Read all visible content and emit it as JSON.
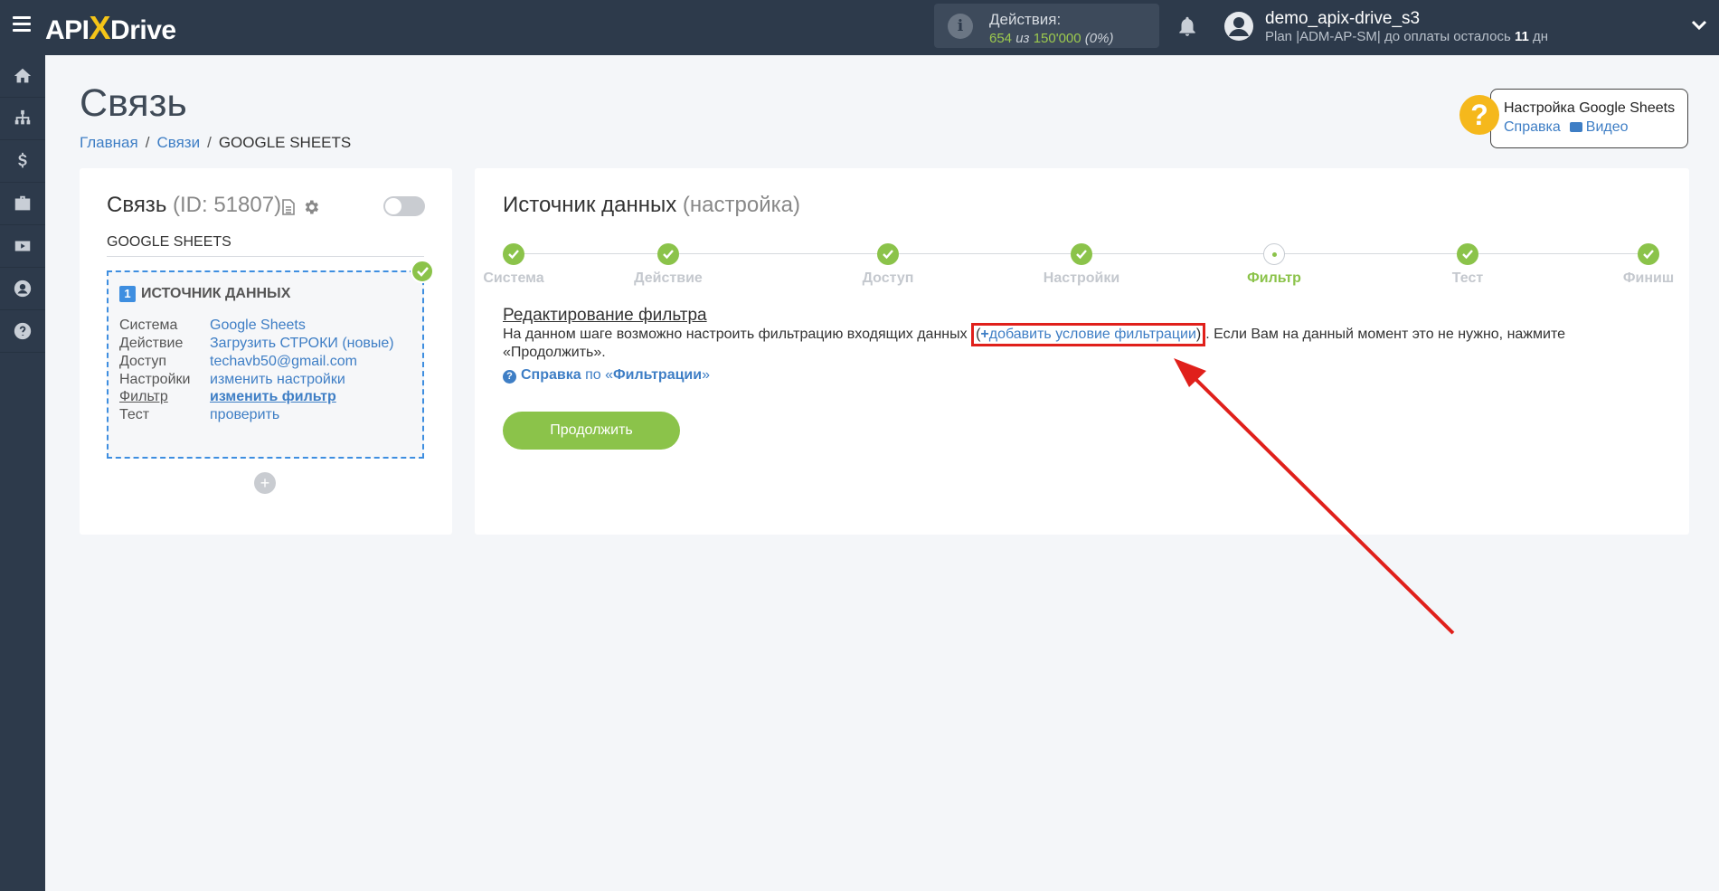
{
  "header": {
    "logo_left": "API",
    "logo_x": "X",
    "logo_right": "Drive",
    "actions_label": "Действия:",
    "actions_used": "654",
    "actions_of": "из",
    "actions_total": "150'000",
    "actions_pct": "(0%)",
    "user_name": "demo_apix-drive_s3",
    "plan_text": "Plan |ADM-AP-SM| до оплаты осталось",
    "plan_days": "11",
    "plan_days_unit": "дн"
  },
  "sidebar": {
    "items": [
      "home-icon",
      "sitemap-icon",
      "dollar-icon",
      "briefcase-icon",
      "youtube-icon",
      "user-icon",
      "help-icon"
    ]
  },
  "page": {
    "title": "Связь",
    "breadcrumb": [
      "Главная",
      "Связи",
      "GOOGLE SHEETS"
    ]
  },
  "help_box": {
    "title": "Настройка Google Sheets",
    "help": "Справка",
    "video": "Видео"
  },
  "connection": {
    "title": "Связь",
    "id_text": "(ID: 51807)",
    "system_name": "GOOGLE SHEETS",
    "source_number": "1",
    "source_title": "ИСТОЧНИК ДАННЫХ",
    "rows": [
      {
        "key": "Система",
        "value": "Google Sheets"
      },
      {
        "key": "Действие",
        "value": "Загрузить СТРОКИ (новые)"
      },
      {
        "key": "Доступ",
        "value": "techavb50@gmail.com"
      },
      {
        "key": "Настройки",
        "value": "изменить настройки"
      },
      {
        "key": "Фильтр",
        "value": "изменить фильтр"
      },
      {
        "key": "Тест",
        "value": "проверить"
      }
    ],
    "add_label": "+"
  },
  "source": {
    "title": "Источник данных",
    "subtitle": "(настройка)",
    "steps": [
      "Система",
      "Действие",
      "Доступ",
      "Настройки",
      "Фильтр",
      "Тест",
      "Финиш"
    ],
    "current_step": "Фильтр",
    "edit_title": "Редактирование фильтра",
    "desc_before": "На данном шаге возможно настроить фильтрацию входящих данных",
    "add_condition": "добавить условие фильтрации",
    "desc_after": ". Если Вам на данный момент это не нужно, нажмите «Продолжить».",
    "help_bold": "Справка",
    "help_mid": "по «",
    "help_bold2": "Фильтрации",
    "help_end": "»",
    "continue_label": "Продолжить"
  },
  "colors": {
    "topbar": "#2d3a4b",
    "accent_green": "#8bc34a",
    "link_blue": "#3e7ec5",
    "highlight_red": "#e0201b",
    "help_yellow": "#f5b81c"
  }
}
